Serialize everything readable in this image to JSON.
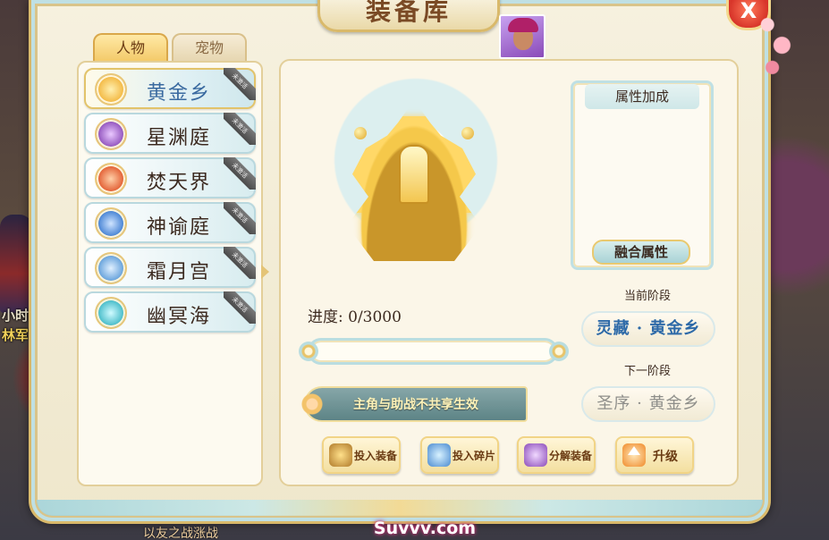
{
  "window": {
    "title": "装备库",
    "close_label": "X"
  },
  "tabs": [
    {
      "label": "人物",
      "active": true
    },
    {
      "label": "宠物",
      "active": false
    }
  ],
  "list": {
    "items": [
      {
        "label": "黄金乡",
        "ribbon": "未激活",
        "icon": "golden-tower-icon",
        "color": "#f2b43a",
        "active": true
      },
      {
        "label": "星渊庭",
        "ribbon": "未激活",
        "icon": "purple-crystal-icon",
        "color": "#8a4ab8",
        "active": false
      },
      {
        "label": "焚天界",
        "ribbon": "未激活",
        "icon": "fire-crystal-icon",
        "color": "#e0552a",
        "active": false
      },
      {
        "label": "神谕庭",
        "ribbon": "未激活",
        "icon": "blue-crystal-icon",
        "color": "#3a7ad0",
        "active": false
      },
      {
        "label": "霜月宫",
        "ribbon": "未激活",
        "icon": "frost-moon-icon",
        "color": "#5a9ad8",
        "active": false
      },
      {
        "label": "幽冥海",
        "ribbon": "未激活",
        "icon": "sea-crystal-icon",
        "color": "#3ab6c4",
        "active": false
      }
    ]
  },
  "progress": {
    "label": "进度: 0/3000",
    "fraction": 0
  },
  "notice": "主角与助战不共享生效",
  "attributes": {
    "title": "属性加成",
    "fusion_button": "融合属性"
  },
  "stages": {
    "current_caption": "当前阶段",
    "current_value": "灵藏 · 黄金乡",
    "next_caption": "下一阶段",
    "next_value": "圣序 · 黄金乡"
  },
  "actions": {
    "put_equip": "投入装备",
    "put_fragments": "投入碎片",
    "decompose": "分解装备",
    "upgrade": "升级"
  },
  "background": {
    "side_text_1": "小时",
    "side_text_2": "林军",
    "bottom_text": "以友之战涨战",
    "watermark": "Suvvv.com"
  }
}
